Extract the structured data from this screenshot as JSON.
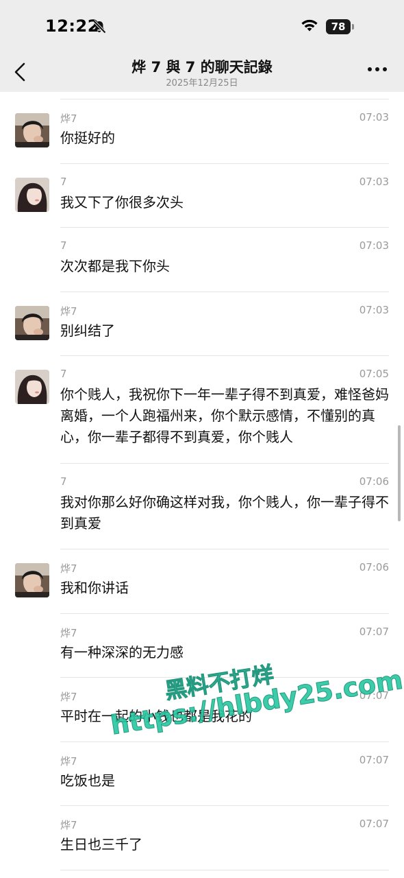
{
  "status_bar": {
    "time": "12:22",
    "battery": "78"
  },
  "header": {
    "title": "烨 7 與 7 的聊天記錄",
    "subtitle": "2025年12月25日"
  },
  "colors": {
    "background": "#ffffff",
    "header_bg": "#ededed",
    "meta_text": "#9a9a9a",
    "watermark": "#27c7a0"
  },
  "messages": [
    {
      "sender": "烨7",
      "time": "07:03",
      "text": "你挺好的",
      "avatar": "avatar-male"
    },
    {
      "sender": "7",
      "time": "07:03",
      "text": "我又下了你很多次头",
      "avatar": "avatar-female"
    },
    {
      "sender": "7",
      "time": "07:03",
      "text": "次次都是我下你头",
      "avatar": ""
    },
    {
      "sender": "烨7",
      "time": "07:03",
      "text": "别纠结了",
      "avatar": "avatar-male"
    },
    {
      "sender": "7",
      "time": "07:05",
      "text": "你个贱人，我祝你下一年一辈子得不到真爱，难怪爸妈离婚，一个人跑福州来，你个默示感情，不懂别的真心，你一辈子都得不到真爱，你个贱人",
      "avatar": "avatar-female"
    },
    {
      "sender": "7",
      "time": "07:06",
      "text": "我对你那么好你确这样对我，你个贱人，你一辈子得不到真爱",
      "avatar": ""
    },
    {
      "sender": "烨7",
      "time": "07:06",
      "text": "我和你讲话",
      "avatar": "avatar-male"
    },
    {
      "sender": "烨7",
      "time": "07:07",
      "text": "有一种深深的无力感",
      "avatar": ""
    },
    {
      "sender": "烨7",
      "time": "07:07",
      "text": "平时在一起的小钱也都是我花的",
      "avatar": ""
    },
    {
      "sender": "烨7",
      "time": "07:07",
      "text": "吃饭也是",
      "avatar": ""
    },
    {
      "sender": "烨7",
      "time": "07:07",
      "text": "生日也三千了",
      "avatar": ""
    }
  ],
  "watermark": {
    "line1": "黑料不打烊",
    "line2": "https://hlbdy25.com"
  }
}
